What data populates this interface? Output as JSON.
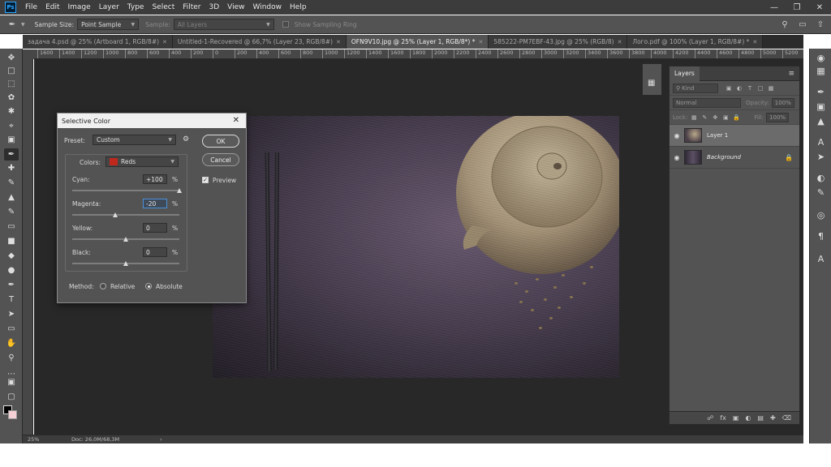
{
  "app": {
    "logo": "Ps"
  },
  "menu": [
    "File",
    "Edit",
    "Image",
    "Layer",
    "Type",
    "Select",
    "Filter",
    "3D",
    "View",
    "Window",
    "Help"
  ],
  "options": {
    "sample_size_label": "Sample Size:",
    "sample_size_value": "Point Sample",
    "sample_label": "Sample:",
    "sample_value": "All Layers",
    "sampling_ring_label": "Show Sampling Ring"
  },
  "tabs": [
    {
      "label": "задача 4.psd @ 25% (Artboard 1, RGB/8#)",
      "active": false
    },
    {
      "label": "Untitled-1-Recovered @ 66,7% (Layer 23, RGB/8#)",
      "active": false
    },
    {
      "label": "OFN9V10.jpg @ 25% (Layer 1, RGB/8*) *",
      "active": true
    },
    {
      "label": "585222-PM7EBF-43.jpg @ 25% (RGB/8)",
      "active": false
    },
    {
      "label": "Лого.pdf @ 100% (Layer 1, RGB/8#) *",
      "active": false
    }
  ],
  "ruler_ticks": [
    "1600",
    "1400",
    "1200",
    "1000",
    "800",
    "600",
    "400",
    "200",
    "0",
    "200",
    "400",
    "600",
    "800",
    "1000",
    "1200",
    "1400",
    "1600",
    "1800",
    "2000",
    "2200",
    "2400",
    "2600",
    "2800",
    "3000",
    "3200",
    "3400",
    "3600",
    "3800",
    "4000",
    "4200",
    "4400",
    "4600",
    "4800",
    "5000",
    "5200"
  ],
  "status": {
    "zoom": "25%",
    "doc": "Doc: 26,0M/68,3M"
  },
  "colors": {
    "foreground": "#000000",
    "background": "#f5d0d5",
    "reds_swatch": "#c0281e"
  },
  "layers_panel": {
    "tab": "Layers",
    "kind_placeholder": "Kind",
    "blend_mode": "Normal",
    "opacity_label": "Opacity:",
    "opacity_value": "100%",
    "lock_label": "Lock:",
    "fill_label": "Fill:",
    "fill_value": "100%",
    "layers": [
      {
        "name": "Layer 1",
        "selected": true
      },
      {
        "name": "Background",
        "selected": false
      }
    ]
  },
  "dialog": {
    "title": "Selective Color",
    "preset_label": "Preset:",
    "preset_value": "Custom",
    "ok": "OK",
    "cancel": "Cancel",
    "preview": "Preview",
    "colors_label": "Colors:",
    "colors_value": "Reds",
    "sliders": [
      {
        "label": "Cyan:",
        "value": "+100",
        "level": 100
      },
      {
        "label": "Magenta:",
        "value": "-20",
        "level": -20
      },
      {
        "label": "Yellow:",
        "value": "0",
        "level": 0
      },
      {
        "label": "Black:",
        "value": "0",
        "level": 0
      }
    ],
    "pct": "%",
    "method_label": "Method:",
    "method_relative": "Relative",
    "method_absolute": "Absolute"
  }
}
